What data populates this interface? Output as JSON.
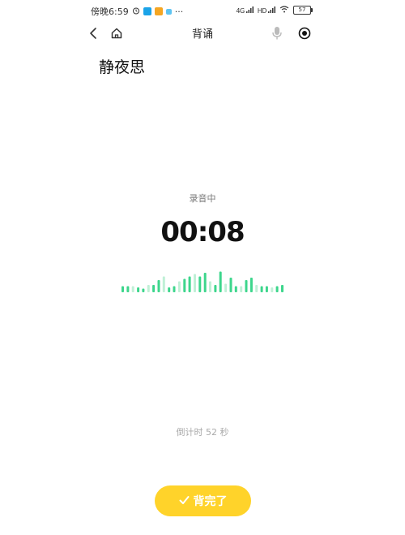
{
  "status_bar": {
    "time": "傍晚6:59",
    "more": "···",
    "signal1": "4G",
    "signal2": "HD",
    "battery": "57"
  },
  "nav": {
    "title": "背诵",
    "back_icon": "chevron-left-icon",
    "home_icon": "home-icon",
    "mic_icon": "microphone-icon",
    "record_icon": "record-icon"
  },
  "poem": {
    "title": "静夜思"
  },
  "recording": {
    "label": "录音中",
    "elapsed": "00:08",
    "countdown": "倒计时 52 秒",
    "wave_levels": [
      0.25,
      0.25,
      0.25,
      0.2,
      0.15,
      0.3,
      0.3,
      0.5,
      0.65,
      0.2,
      0.25,
      0.45,
      0.55,
      0.65,
      0.75,
      0.65,
      0.8,
      0.45,
      0.3,
      0.85,
      0.35,
      0.6,
      0.25,
      0.25,
      0.5,
      0.6,
      0.3,
      0.25,
      0.25,
      0.2,
      0.25,
      0.3
    ],
    "wave_color_strong": "#3dd68c",
    "wave_color_light": "#bff0d6"
  },
  "actions": {
    "done_label": "背完了",
    "done_color": "#ffd32a"
  }
}
